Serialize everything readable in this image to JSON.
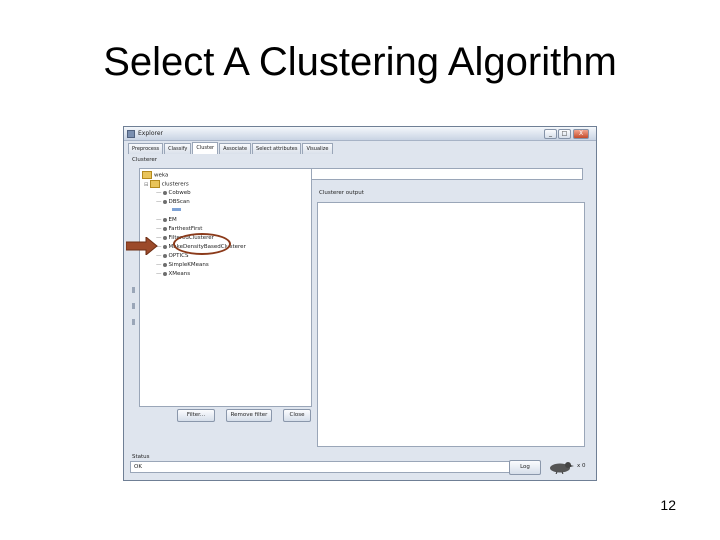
{
  "slide": {
    "title": "Select A Clustering Algorithm",
    "page_number": "12"
  },
  "window": {
    "title": "Explorer",
    "controls": [
      "_",
      "□",
      "X"
    ],
    "tabs": [
      "Preprocess",
      "Classify",
      "Cluster",
      "Associate",
      "Select attributes",
      "Visualize"
    ],
    "active_tab": "Cluster",
    "clusterer_section_label": "Clusterer",
    "tree": {
      "root": "weka",
      "folder": "clusterers",
      "items": [
        "Cobweb",
        "DBScan",
        "EM",
        "FarthestFirst",
        "FilteredClusterer",
        "MakeDensityBasedClusterer",
        "OPTICS",
        "SimpleKMeans",
        "XMeans"
      ],
      "selected": "DBScan"
    },
    "popup_buttons": [
      "Filter...",
      "Remove filter",
      "Close"
    ],
    "output_label": "Clusterer output",
    "status_label": "Status",
    "status_text": "OK",
    "log_button": "Log",
    "x_count": "x 0"
  },
  "colors": {
    "highlight_ellipse": "#8b3a1a",
    "pointer_arrow": "#9c4a2a"
  },
  "icons": {
    "arrow": "right-arrow-icon",
    "folder": "folder-icon",
    "weka_bird": "weka-bird-icon"
  }
}
